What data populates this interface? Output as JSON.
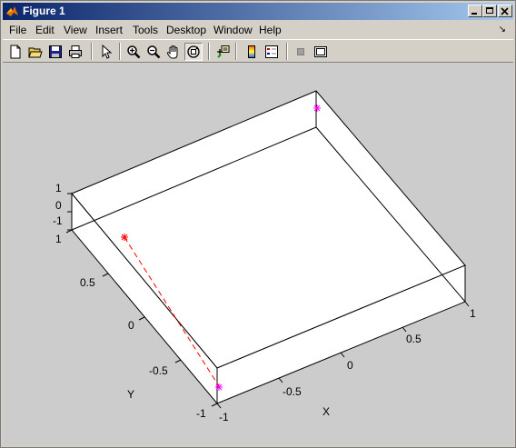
{
  "window": {
    "title": "Figure 1"
  },
  "menu": {
    "items": [
      "File",
      "Edit",
      "View",
      "Insert",
      "Tools",
      "Desktop",
      "Window",
      "Help"
    ],
    "dock_arrow": "↘"
  },
  "toolbar": {
    "buttons": [
      "new-figure-icon",
      "open-file-icon",
      "save-icon",
      "print-icon",
      "edit-plot-arrow-icon",
      "zoom-in-icon",
      "zoom-out-icon",
      "pan-hand-icon",
      "rotate-3d-icon",
      "data-cursor-icon",
      "insert-colorbar-icon",
      "insert-legend-icon",
      "hide-plot-tools-icon",
      "show-plot-tools-icon"
    ],
    "active": "rotate-3d-icon"
  },
  "colors": {
    "titlebar_start": "#0a246a",
    "titlebar_end": "#a6caf0",
    "figure_background": "#cccccc",
    "axes_background": "#ffffff",
    "marker": "#ff00ff",
    "line": "#ff0000"
  },
  "plot": {
    "z_ticks": [
      "1",
      "0",
      "-1"
    ],
    "y_ticks": [
      "1",
      "0.5",
      "0",
      "-0.5",
      "-1"
    ],
    "x_ticks": [
      "-1",
      "-0.5",
      "0",
      "0.5",
      "1"
    ],
    "x_label": "X",
    "y_label": "Y"
  },
  "chart_data": {
    "type": "scatter",
    "view": "3d",
    "xlim": [
      -1,
      1
    ],
    "ylim": [
      -1,
      1
    ],
    "zlim": [
      -1,
      1
    ],
    "xlabel": "X",
    "ylabel": "Y",
    "zlabel": "",
    "box": true,
    "grid": false,
    "series": [
      {
        "marker": "*",
        "marker_color": "#ff00ff",
        "points": [
          {
            "x": 1,
            "y": 1,
            "z": 1
          },
          {
            "x": -1,
            "y": -1,
            "z": 1
          }
        ]
      },
      {
        "line_style": "dashed",
        "line_color": "#ff0000",
        "marker": "*",
        "points": [
          {
            "x": -1,
            "y": 1,
            "z": 1
          },
          {
            "x": -1,
            "y": -1,
            "z": 1
          }
        ]
      }
    ]
  }
}
